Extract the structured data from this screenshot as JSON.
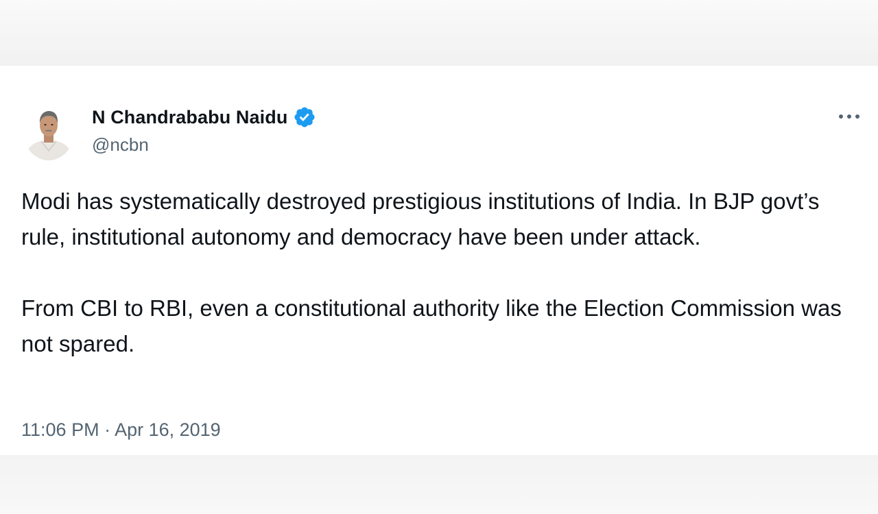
{
  "author": {
    "display_name": "N Chandrababu Naidu",
    "handle": "@ncbn",
    "verified_icon": "verified-badge-icon",
    "avatar": "profile-photo"
  },
  "menu": {
    "icon": "more-options-icon"
  },
  "tweet": {
    "paragraph_1": "Modi has systematically destroyed prestigious institutions of India. In BJP govt’s rule, institutional autonomy and democracy have been under attack.",
    "paragraph_2": "From CBI to RBI, even a constitutional authority like the Election Commission was not spared.",
    "timestamp": "11:06 PM · Apr 16, 2019"
  },
  "colors": {
    "text_primary": "#0f1419",
    "text_secondary": "#536471",
    "verified_blue": "#1d9bf0",
    "card_background": "#ffffff",
    "page_background": "#f0f0f0"
  }
}
